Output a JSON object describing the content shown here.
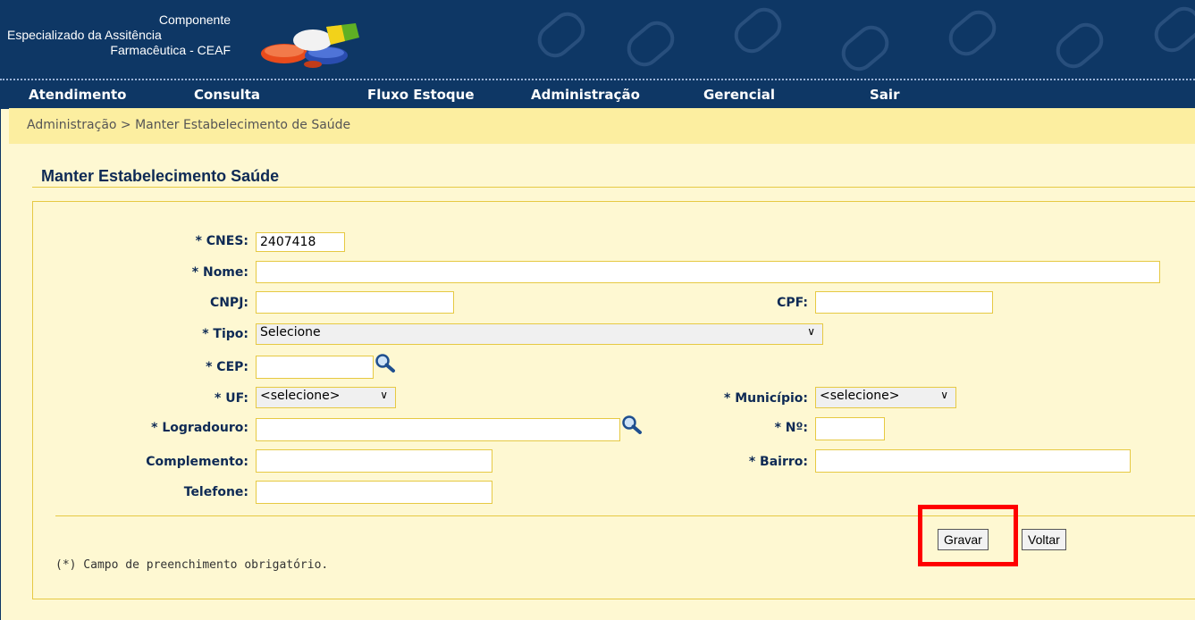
{
  "header": {
    "logo_lines": [
      "Componente",
      "Especializado da Assitência",
      "Farmacêutica - CEAF"
    ]
  },
  "nav": {
    "items": [
      "Atendimento",
      "Consulta",
      "Fluxo Estoque",
      "Administração",
      "Gerencial",
      "Sair"
    ]
  },
  "breadcrumb": "Administração > Manter Estabelecimento de Saúde",
  "page_title": "Manter Estabelecimento Saúde",
  "form": {
    "cnes_label": "* CNES:",
    "cnes_value": "2407418",
    "nome_label": "* Nome:",
    "nome_value": "",
    "cnpj_label": "CNPJ:",
    "cnpj_value": "",
    "cpf_label": "CPF:",
    "cpf_value": "",
    "tipo_label": "* Tipo:",
    "tipo_selected": "Selecione",
    "cep_label": "* CEP:",
    "cep_value": "",
    "uf_label": "* UF:",
    "uf_selected": "<selecione>",
    "municipio_label": "* Município:",
    "municipio_selected": "<selecione>",
    "logradouro_label": "* Logradouro:",
    "logradouro_value": "",
    "numero_label": "* Nº:",
    "numero_value": "",
    "complemento_label": "Complemento:",
    "complemento_value": "",
    "bairro_label": "* Bairro:",
    "bairro_value": "",
    "telefone_label": "Telefone:",
    "telefone_value": ""
  },
  "buttons": {
    "gravar": "Gravar",
    "voltar": "Voltar"
  },
  "footer_note": "(*) Campo de preenchimento obrigatório.",
  "colors": {
    "header_bg": "#0E3765",
    "page_bg": "#FEF8D2",
    "border": "#E6C943",
    "highlight": "#FF0000"
  },
  "icons": {
    "search": "magnifier-icon",
    "select": "chevron-down-icon"
  }
}
